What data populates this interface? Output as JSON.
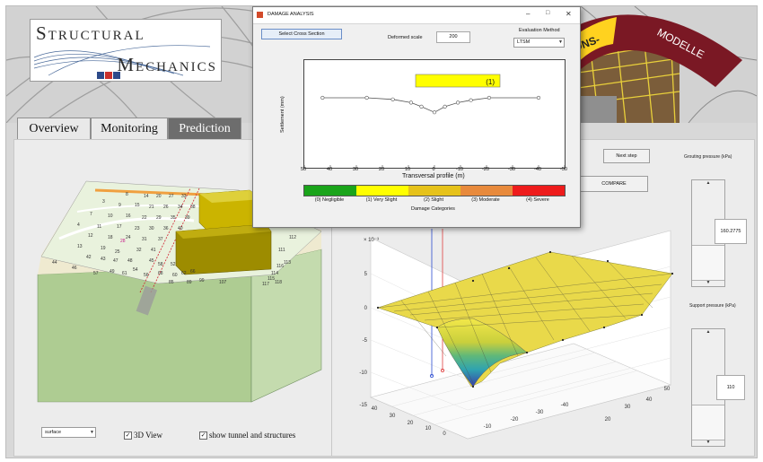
{
  "logo": {
    "line1": "Structural",
    "line2": "Mechanics"
  },
  "banner": {
    "ring_text_1": "IONS-",
    "ring_text_2": "MODELLE"
  },
  "tabs": [
    {
      "label": "Overview",
      "active": false
    },
    {
      "label": "Monitoring",
      "active": false
    },
    {
      "label": "Prediction",
      "active": true
    }
  ],
  "site_labels": [
    "8",
    "14",
    "20",
    "27",
    "33",
    "3",
    "9",
    "15",
    "21",
    "26",
    "34",
    "38",
    "7",
    "10",
    "16",
    "22",
    "29",
    "35",
    "39",
    "4",
    "11",
    "17",
    "23",
    "30",
    "36",
    "40",
    "12",
    "18",
    "24",
    "31",
    "37",
    "13",
    "19",
    "28",
    "32",
    "41",
    "25",
    "45",
    "42",
    "43",
    "47",
    "48",
    "44",
    "46",
    "54",
    "49",
    "58",
    "57",
    "61",
    "52",
    "56",
    "60",
    "62",
    "66",
    "68",
    "85",
    "89",
    "99",
    "107",
    "112",
    "111",
    "113",
    "114",
    "115",
    "116",
    "117",
    "118"
  ],
  "left_controls": {
    "view_select": "surface",
    "view3d_label": "3D View",
    "show_tunnel_label": "show tunnel and structures"
  },
  "right_controls": {
    "next_step_label": "Next step",
    "compare_label": "COMPARE",
    "grouting_label": "Grouting pressure (kPa)",
    "grouting_value": "160.2775",
    "support_label": "Support pressure (kPa)",
    "support_value": "110"
  },
  "plot3d": {
    "exponent": "× 10⁻³",
    "z_ticks": [
      "5",
      "0",
      "-5",
      "-10",
      "-15"
    ],
    "x_ticks": [
      "40",
      "30",
      "20",
      "10",
      "0",
      "-10",
      "-20",
      "-30",
      "-40"
    ],
    "y_ticks": [
      "50",
      "40",
      "30",
      "20"
    ]
  },
  "dialog": {
    "title": "DAMAGE ANALYSIS",
    "select_cross_section": "Select Cross Section",
    "deformed_scale_label": "Deformed scale",
    "deformed_scale_value": "200",
    "evaluation_method_label": "Evaluation Method",
    "evaluation_method_value": "LTSM",
    "plot_ylabel": "Settlement (mm)",
    "plot_xlabel": "Transversal profile (m)",
    "callout": "(1)",
    "damage_title": "Damage Categories",
    "damage_categories": [
      {
        "label": "(0) Negligible",
        "color": "#1aa41a"
      },
      {
        "label": "(1) Very Slight",
        "color": "#ffff00"
      },
      {
        "label": "(2) Slight",
        "color": "#e6c21a"
      },
      {
        "label": "(3) Moderate",
        "color": "#e88a3c"
      },
      {
        "label": "(4) Severe",
        "color": "#ee1c1c"
      }
    ]
  },
  "chart_data": {
    "type": "line",
    "xlabel": "Transversal profile (m)",
    "ylabel": "Settlement (mm)",
    "xlim": [
      50,
      -50
    ],
    "x_ticks": [
      50,
      40,
      30,
      20,
      10,
      0,
      -10,
      -20,
      -30,
      -40,
      -50
    ],
    "x": [
      43,
      26,
      16,
      9,
      5,
      0,
      -4,
      -9,
      -14,
      -21,
      -40
    ],
    "y": [
      0,
      0,
      -0.2,
      -0.6,
      -1.1,
      -1.8,
      -1.1,
      -0.6,
      -0.3,
      0,
      0
    ]
  }
}
